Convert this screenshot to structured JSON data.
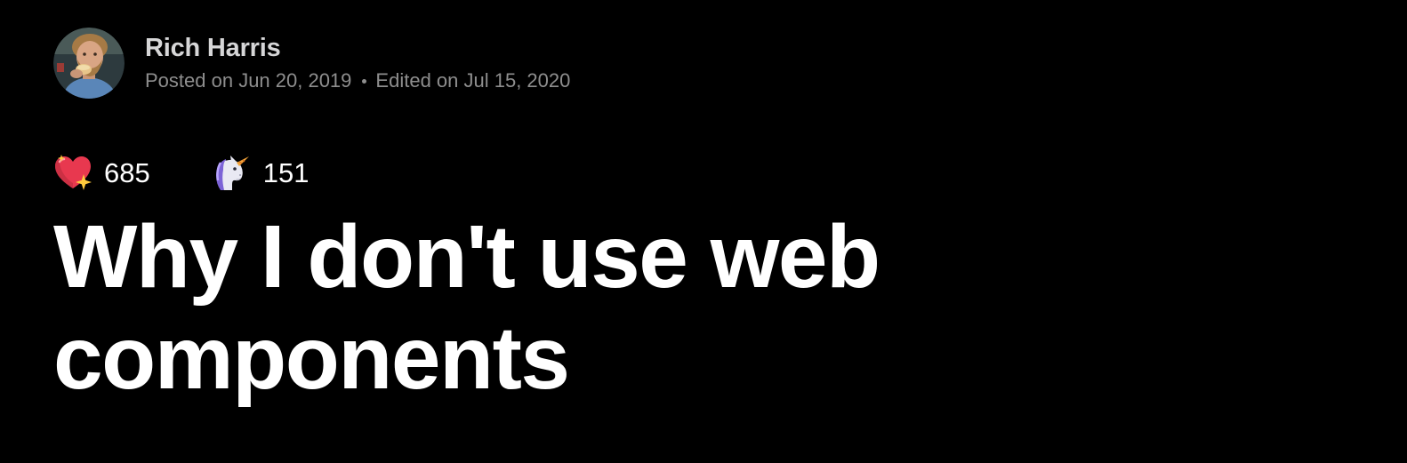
{
  "author": {
    "name": "Rich Harris",
    "avatar_icon": "author-avatar"
  },
  "dates": {
    "posted": "Posted on Jun 20, 2019",
    "edited": "Edited on Jul 15, 2020"
  },
  "reactions": [
    {
      "icon": "sparkle-heart-icon",
      "count": "685"
    },
    {
      "icon": "unicorn-icon",
      "count": "151"
    }
  ],
  "article": {
    "title": "Why I don't use web components"
  },
  "colors": {
    "background": "#000000",
    "title": "#ffffff",
    "author_name": "#d6d6d7",
    "meta": "#8e8e8e"
  }
}
